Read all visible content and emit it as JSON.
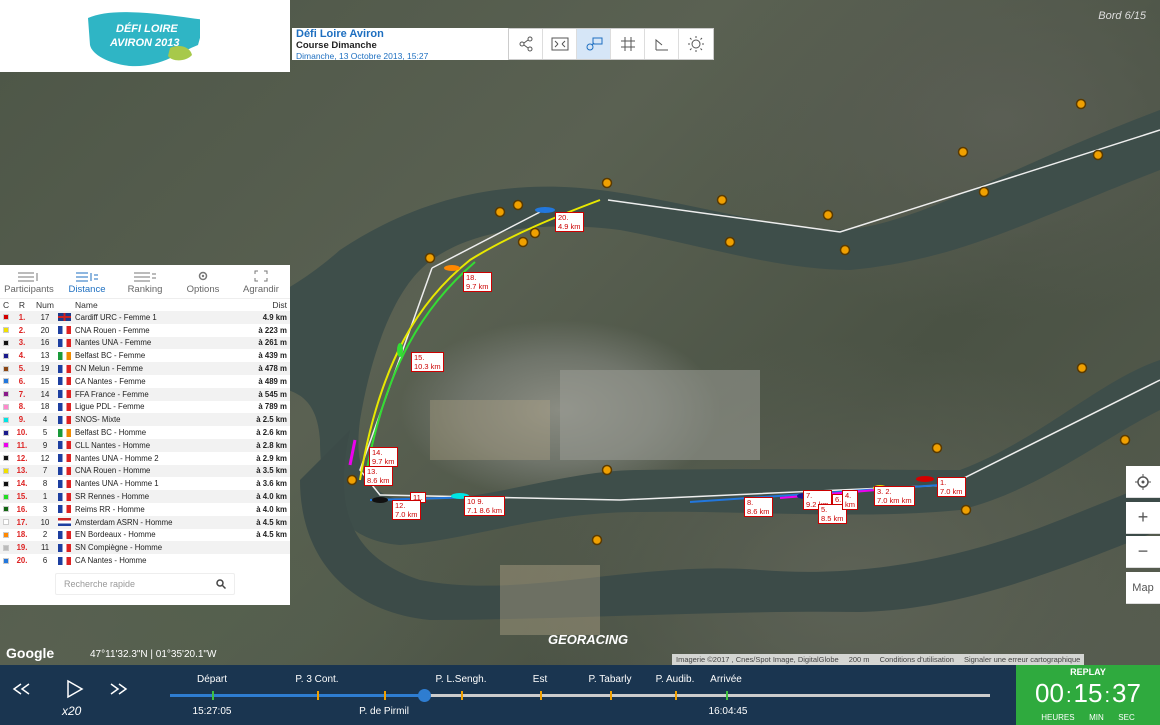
{
  "event": {
    "title": "Défi Loire Aviron",
    "course": "Course Dimanche",
    "date": "Dimanche, 13 Octobre 2013, 15:27"
  },
  "logo": {
    "line1": "DÉFI LOIRE",
    "line2": "AVIRON 2013"
  },
  "toolbar": [
    "share-icon",
    "fullscreen-icon",
    "follow-icon",
    "grid-icon",
    "ruler-icon",
    "sun-icon"
  ],
  "board_label": "Bord 6/15",
  "panel": {
    "tabs": [
      {
        "label": "Participants",
        "icon": "participants-icon",
        "active": false
      },
      {
        "label": "Distance",
        "icon": "distance-icon",
        "active": true
      },
      {
        "label": "Ranking",
        "icon": "ranking-icon",
        "active": false
      },
      {
        "label": "Options",
        "icon": "gear-icon",
        "active": false
      },
      {
        "label": "Agrandir",
        "icon": "expand-icon",
        "active": false
      }
    ],
    "headers": {
      "c": "C",
      "r": "R",
      "num": "Num",
      "name": "Name",
      "dist": "Dist"
    },
    "rows": [
      {
        "color": "#d40000",
        "rank": "1.",
        "num": "17",
        "flag": "uk",
        "name": "Cardiff URC - Femme 1",
        "dist": "4.9 km"
      },
      {
        "color": "#f0e000",
        "rank": "2.",
        "num": "20",
        "flag": "fr",
        "name": "CNA Rouen - Femme",
        "dist": "à 223 m"
      },
      {
        "color": "#111111",
        "rank": "3.",
        "num": "16",
        "flag": "fr",
        "name": "Nantes UNA - Femme",
        "dist": "à 261 m"
      },
      {
        "color": "#1a1a8c",
        "rank": "4.",
        "num": "13",
        "flag": "ie",
        "name": "Belfast BC - Femme",
        "dist": "à 439 m"
      },
      {
        "color": "#8b4513",
        "rank": "5.",
        "num": "19",
        "flag": "fr",
        "name": "CN Melun - Femme",
        "dist": "à 478 m"
      },
      {
        "color": "#2277dd",
        "rank": "6.",
        "num": "15",
        "flag": "fr",
        "name": "CA Nantes - Femme",
        "dist": "à 489 m"
      },
      {
        "color": "#8a1a8a",
        "rank": "7.",
        "num": "14",
        "flag": "fr",
        "name": "FFA France - Femme",
        "dist": "à 545 m"
      },
      {
        "color": "#ff88cc",
        "rank": "8.",
        "num": "18",
        "flag": "fr",
        "name": "Ligue PDL - Femme",
        "dist": "à 789 m"
      },
      {
        "color": "#00e5e5",
        "rank": "9.",
        "num": "4",
        "flag": "fr",
        "name": "SNOS- Mixte",
        "dist": "à 2.5 km"
      },
      {
        "color": "#1a1a8c",
        "rank": "10.",
        "num": "5",
        "flag": "ie",
        "name": "Belfast BC - Homme",
        "dist": "à 2.6 km"
      },
      {
        "color": "#ee00ee",
        "rank": "11.",
        "num": "9",
        "flag": "fr",
        "name": "CLL Nantes - Homme",
        "dist": "à 2.8 km"
      },
      {
        "color": "#111111",
        "rank": "12.",
        "num": "12",
        "flag": "fr",
        "name": "Nantes UNA - Homme 2",
        "dist": "à 2.9 km"
      },
      {
        "color": "#f0e000",
        "rank": "13.",
        "num": "7",
        "flag": "fr",
        "name": "CNA Rouen - Homme",
        "dist": "à 3.5 km"
      },
      {
        "color": "#111111",
        "rank": "14.",
        "num": "8",
        "flag": "fr",
        "name": "Nantes UNA - Homme 1",
        "dist": "à 3.6 km"
      },
      {
        "color": "#22dd22",
        "rank": "15.",
        "num": "1",
        "flag": "fr",
        "name": "SR Rennes - Homme",
        "dist": "à 4.0 km"
      },
      {
        "color": "#116611",
        "rank": "16.",
        "num": "3",
        "flag": "fr",
        "name": "Reims RR - Homme",
        "dist": "à 4.0 km"
      },
      {
        "color": "#ffffff",
        "rank": "17.",
        "num": "10",
        "flag": "nl",
        "name": "Amsterdam ASRN - Homme",
        "dist": "à 4.5 km"
      },
      {
        "color": "#ff8800",
        "rank": "18.",
        "num": "2",
        "flag": "fr",
        "name": "EN Bordeaux - Homme",
        "dist": "à 4.5 km"
      },
      {
        "color": "#bbbbbb",
        "rank": "19.",
        "num": "11",
        "flag": "fr",
        "name": "SN Compiègne - Homme",
        "dist": ""
      },
      {
        "color": "#2277dd",
        "rank": "20.",
        "num": "6",
        "flag": "fr",
        "name": "CA Nantes - Homme",
        "dist": ""
      }
    ],
    "search_placeholder": "Recherche rapide"
  },
  "map": {
    "controls": {
      "locate": "locate-icon",
      "zoom_in": "+",
      "zoom_out": "−",
      "map_type": "Map"
    },
    "boat_labels": [
      {
        "text": "20.",
        "sub": "4.9 km"
      },
      {
        "text": "18.",
        "sub": "9.7 km"
      },
      {
        "text": "15.",
        "sub": "10.3 km"
      },
      {
        "text": "14.",
        "sub": "9.7 km"
      },
      {
        "text": "13.",
        "sub": "8.6 km"
      },
      {
        "text": "11.",
        "sub": ""
      },
      {
        "text": "12.",
        "sub": "7.0 km"
      },
      {
        "text": "10 9.",
        "sub": "7.1 8.6 km"
      },
      {
        "text": "8.",
        "sub": "8.6 km"
      },
      {
        "text": "7.",
        "sub": "9.2 km"
      },
      {
        "text": "6.",
        "sub": ""
      },
      {
        "text": "5.",
        "sub": "8.5 km"
      },
      {
        "text": "4.",
        "sub": "km"
      },
      {
        "text": "3. 2.",
        "sub": "7.0 km km"
      },
      {
        "text": "1.",
        "sub": "7.0 km"
      }
    ],
    "google": "Google",
    "coords": "47°11'32.3\"N | 01°35'20.1\"W",
    "brand": "GEORACING",
    "attribution": [
      "Imagerie ©2017 , Cnes/Spot Image, DigitalGlobe",
      "200 m",
      "Conditions d'utilisation",
      "Signaler une erreur cartographique"
    ]
  },
  "timeline": {
    "speed": "x20",
    "start_time": "15:27:05",
    "end_time": "16:04:45",
    "progress": 0.31,
    "markers_top": [
      {
        "label": "Départ",
        "color": "#3fbf3f"
      },
      {
        "label": "P. 3 Cont.",
        "color": "#f0a000"
      },
      {
        "label": "P. L.Sengh.",
        "color": "#f0a000"
      },
      {
        "label": "Est",
        "color": "#f0a000"
      },
      {
        "label": "P. Tabarly",
        "color": "#f0a000"
      },
      {
        "label": "P. Audib.",
        "color": "#f0a000"
      },
      {
        "label": "Arrivée",
        "color": "#3fbf3f"
      }
    ],
    "marker_bottom": {
      "label": "P. de Pirmil",
      "color": "#f0a000"
    }
  },
  "replay": {
    "label": "REPLAY",
    "hours": "00",
    "minutes": "15",
    "seconds": "37",
    "units": [
      "HEURES",
      "MIN",
      "SEC"
    ]
  }
}
